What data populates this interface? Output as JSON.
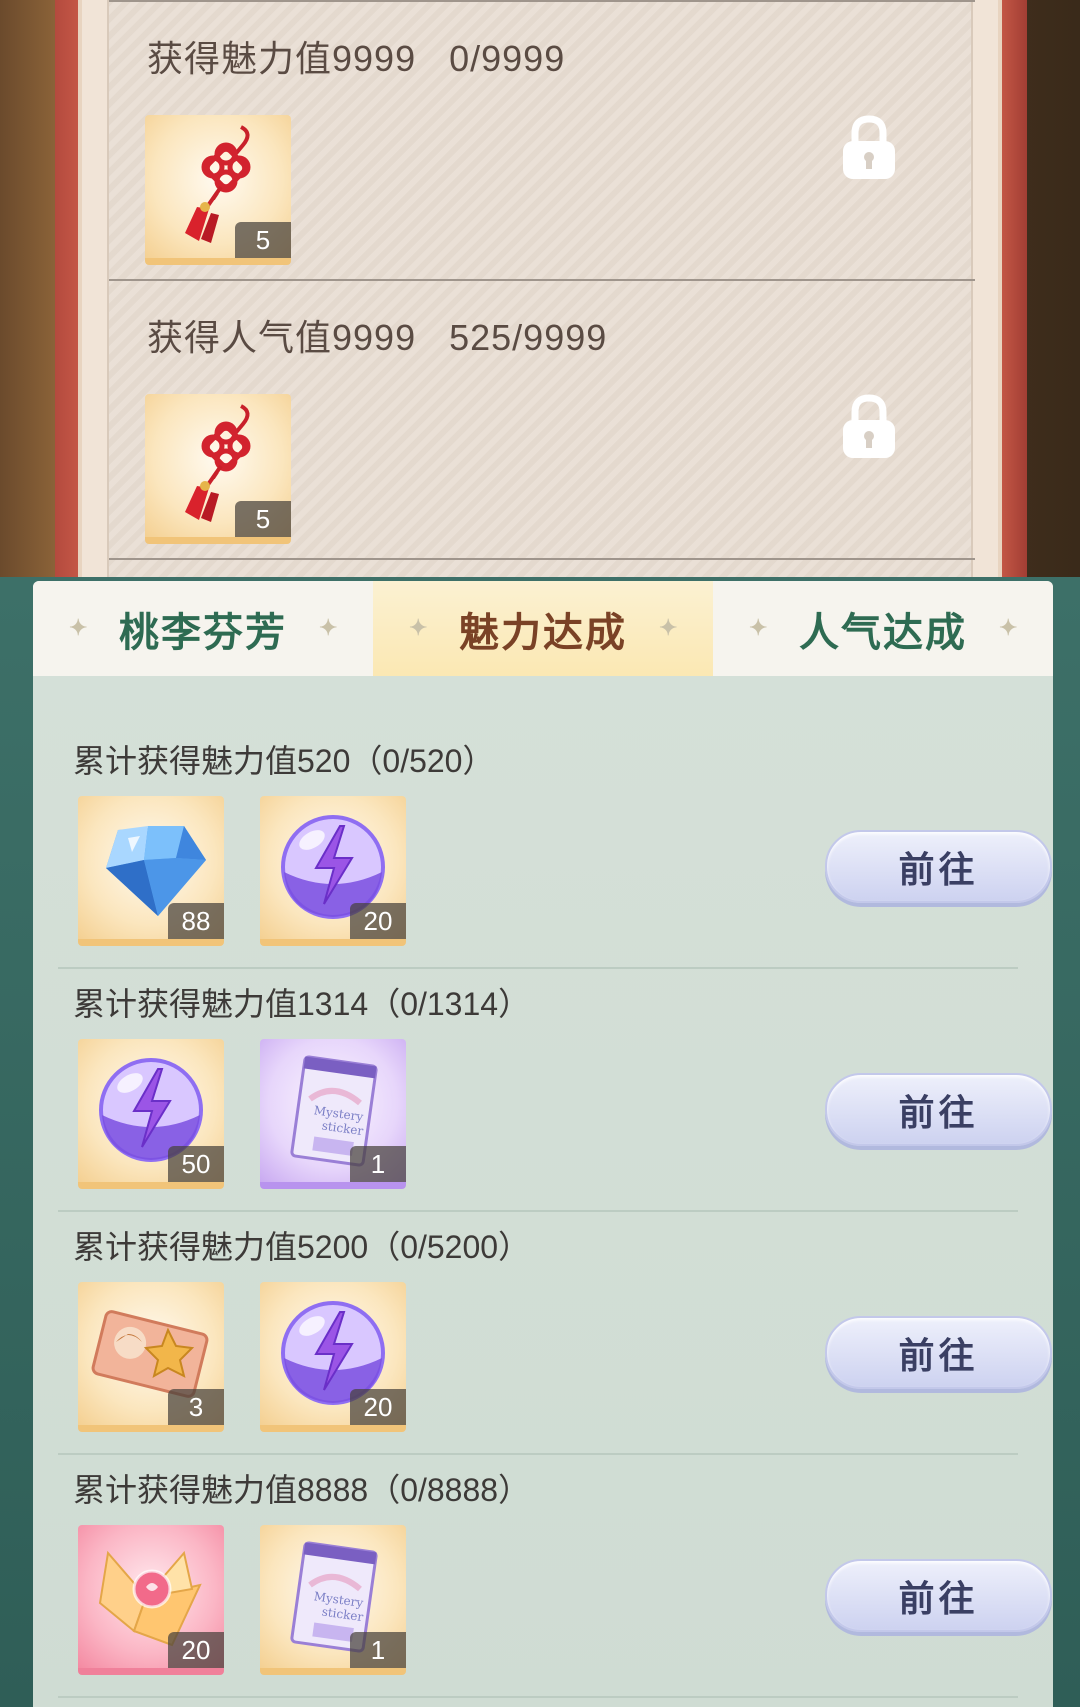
{
  "top_panel": {
    "tasks": [
      {
        "title": "获得魅力值9999",
        "progress": "0/9999",
        "reward": {
          "icon": "chinese-knot-icon",
          "count": "5"
        },
        "status": "locked"
      },
      {
        "title": "获得人气值9999",
        "progress": "525/9999",
        "reward": {
          "icon": "chinese-knot-icon",
          "count": "5"
        },
        "status": "locked"
      }
    ]
  },
  "tabs": [
    {
      "label": "桃李芬芳",
      "active": false
    },
    {
      "label": "魅力达成",
      "active": true
    },
    {
      "label": "人气达成",
      "active": false
    }
  ],
  "tasks": [
    {
      "title": "累计获得魅力值520（0/520）",
      "rewards": [
        {
          "icon": "diamond-icon",
          "count": "88",
          "frame": "gold"
        },
        {
          "icon": "energy-orb-icon",
          "count": "20",
          "frame": "gold"
        }
      ],
      "button": "前往"
    },
    {
      "title": "累计获得魅力值1314（0/1314）",
      "rewards": [
        {
          "icon": "energy-orb-icon",
          "count": "50",
          "frame": "gold"
        },
        {
          "icon": "mystery-sticker-pack-icon",
          "count": "1",
          "frame": "purple"
        }
      ],
      "button": "前往"
    },
    {
      "title": "累计获得魅力值5200（0/5200）",
      "rewards": [
        {
          "icon": "character-ticket-icon",
          "count": "3",
          "frame": "gold"
        },
        {
          "icon": "energy-orb-icon",
          "count": "20",
          "frame": "gold"
        }
      ],
      "button": "前往"
    },
    {
      "title": "累计获得魅力值8888（0/8888）",
      "rewards": [
        {
          "icon": "paper-crane-icon",
          "count": "20",
          "frame": "pink"
        },
        {
          "icon": "mystery-sticker-pack-icon",
          "count": "1",
          "frame": "gold"
        }
      ],
      "button": "前往"
    }
  ],
  "colors": {
    "tab_active_text": "#7a4226",
    "tab_text": "#2e6b52",
    "button_bg": "#cdd2f0",
    "panel_bg": "#d5e0d8",
    "frame_red": "#c85a48"
  }
}
